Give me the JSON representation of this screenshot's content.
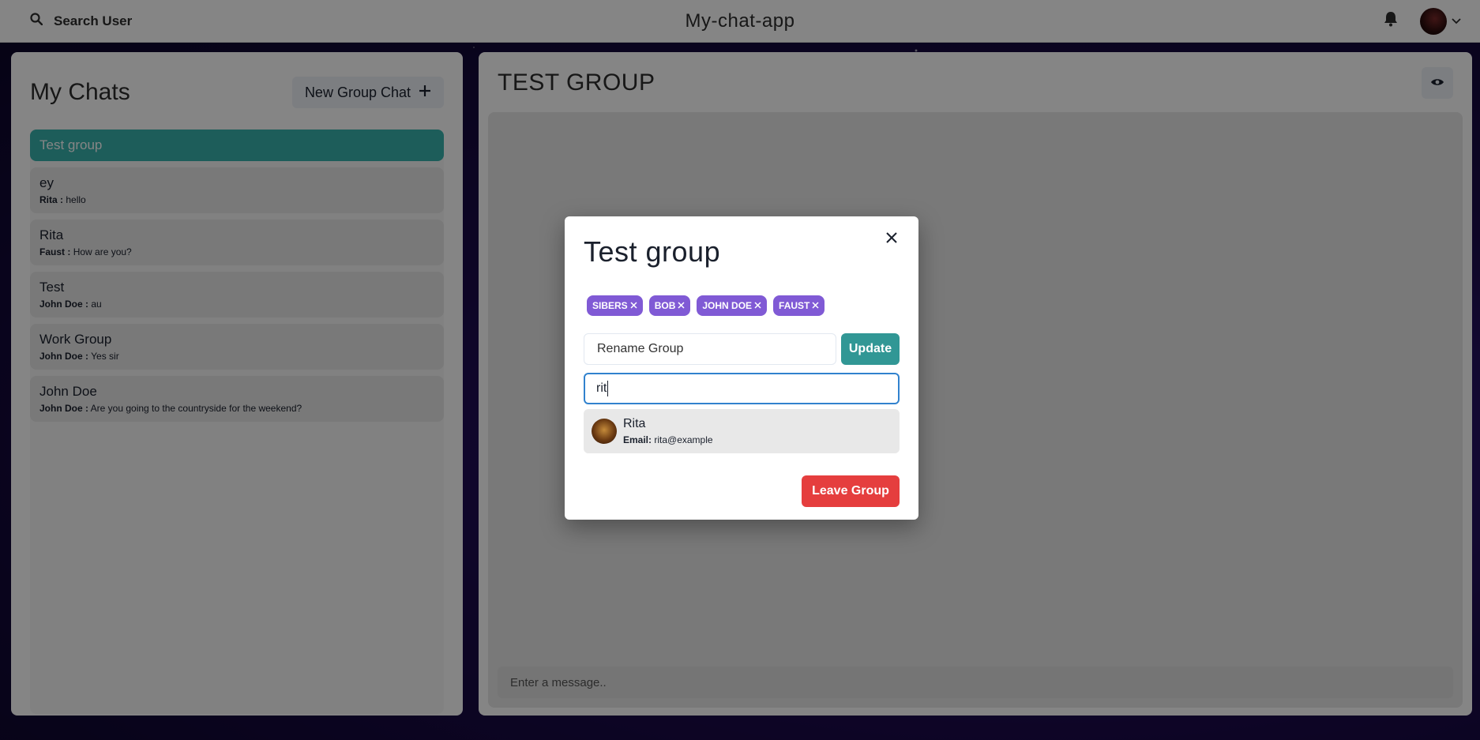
{
  "header": {
    "search_label": "Search User",
    "app_title": "My-chat-app"
  },
  "sidebar": {
    "title": "My Chats",
    "new_group_label": "New Group Chat",
    "chats": [
      {
        "name": "Test group",
        "sender": "",
        "message": "",
        "selected": true
      },
      {
        "name": "ey",
        "sender": "Rita :",
        "message": "hello",
        "selected": false
      },
      {
        "name": "Rita",
        "sender": "Faust :",
        "message": "How are you?",
        "selected": false
      },
      {
        "name": "Test",
        "sender": "John Doe :",
        "message": "au",
        "selected": false
      },
      {
        "name": "Work Group",
        "sender": "John Doe :",
        "message": "Yes sir",
        "selected": false
      },
      {
        "name": "John Doe",
        "sender": "John Doe :",
        "message": "Are you going to the countryside for the weekend?",
        "selected": false
      }
    ]
  },
  "chat": {
    "title": "TEST GROUP",
    "message_placeholder": "Enter a message.."
  },
  "modal": {
    "title": "Test group",
    "members": [
      "SIBERS",
      "BOB",
      "JOHN DOE",
      "FAUST"
    ],
    "rename_placeholder": "Rename Group",
    "update_label": "Update",
    "search_value": "rit",
    "results": [
      {
        "name": "Rita",
        "email_label": "Email:",
        "email": "rita@example"
      }
    ],
    "leave_label": "Leave Group"
  },
  "colors": {
    "selected_chat": "#38b2ac",
    "badge": "#805ad5",
    "update_button": "#319795",
    "leave_button": "#e53e3e",
    "focus_border": "#3182ce"
  }
}
